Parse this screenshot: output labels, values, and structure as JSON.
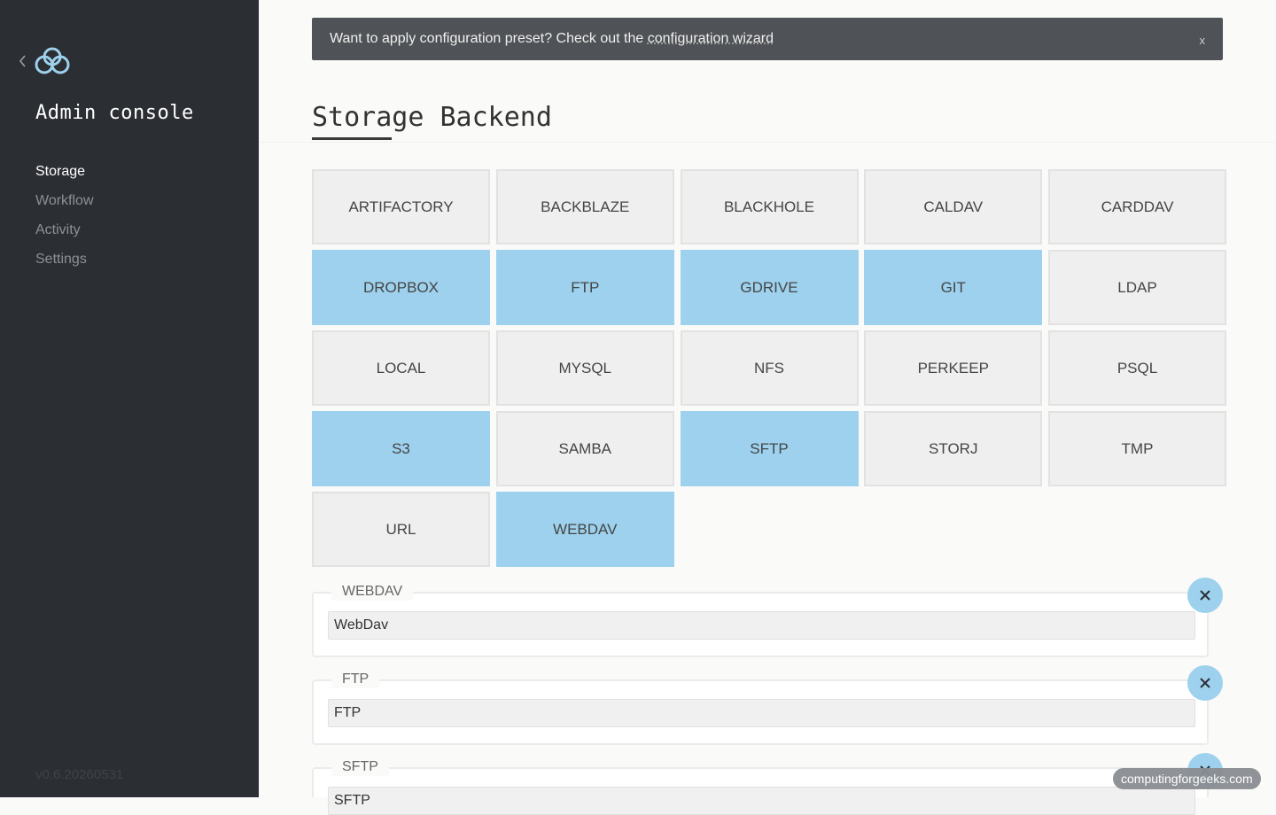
{
  "sidebar": {
    "title": "Admin console",
    "nav": [
      {
        "label": "Storage",
        "active": true
      },
      {
        "label": "Workflow",
        "active": false
      },
      {
        "label": "Activity",
        "active": false
      },
      {
        "label": "Settings",
        "active": false
      }
    ],
    "version": "v0.6.20260531"
  },
  "banner": {
    "text": "Want to apply configuration preset? Check out the ",
    "link": "configuration wizard",
    "close": "x"
  },
  "page": {
    "title": "Storage Backend"
  },
  "backends": [
    {
      "label": "ARTIFACTORY",
      "selected": false
    },
    {
      "label": "BACKBLAZE",
      "selected": false
    },
    {
      "label": "BLACKHOLE",
      "selected": false
    },
    {
      "label": "CALDAV",
      "selected": false
    },
    {
      "label": "CARDDAV",
      "selected": false
    },
    {
      "label": "DROPBOX",
      "selected": true
    },
    {
      "label": "FTP",
      "selected": true
    },
    {
      "label": "GDRIVE",
      "selected": true
    },
    {
      "label": "GIT",
      "selected": true
    },
    {
      "label": "LDAP",
      "selected": false
    },
    {
      "label": "LOCAL",
      "selected": false
    },
    {
      "label": "MYSQL",
      "selected": false
    },
    {
      "label": "NFS",
      "selected": false
    },
    {
      "label": "PERKEEP",
      "selected": false
    },
    {
      "label": "PSQL",
      "selected": false
    },
    {
      "label": "S3",
      "selected": true
    },
    {
      "label": "SAMBA",
      "selected": false
    },
    {
      "label": "SFTP",
      "selected": true
    },
    {
      "label": "STORJ",
      "selected": false
    },
    {
      "label": "TMP",
      "selected": false
    },
    {
      "label": "URL",
      "selected": false
    },
    {
      "label": "WEBDAV",
      "selected": true
    }
  ],
  "configs": [
    {
      "legend": "WEBDAV",
      "value": "WebDav"
    },
    {
      "legend": "FTP",
      "value": "FTP"
    },
    {
      "legend": "SFTP",
      "value": "SFTP"
    }
  ],
  "watermark": "computingforgeeks.com",
  "colors": {
    "sidebar_bg": "#2b2e33",
    "selected_tile": "#9dd1ed",
    "tile_bg": "#efefef",
    "banner_bg": "#4f5256"
  },
  "icons": {
    "logo": "cloud-icon",
    "back": "chevron-left-icon",
    "remove": "close-icon"
  }
}
